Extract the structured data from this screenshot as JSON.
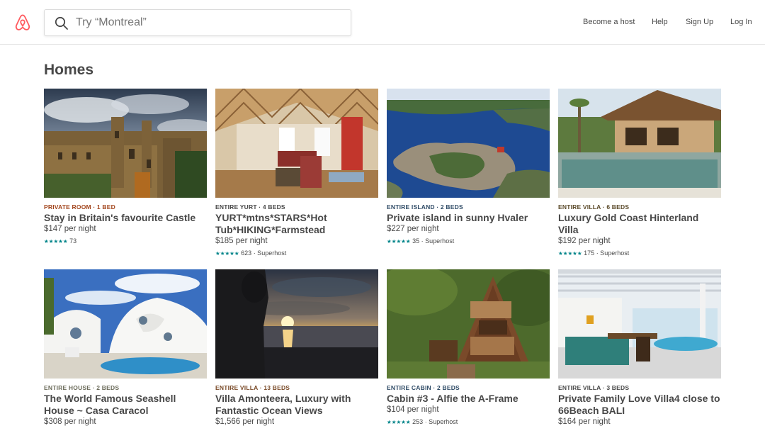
{
  "brand": {
    "accent": "#FF5A5F",
    "logo": "airbnb-belo-logo"
  },
  "search": {
    "placeholder": "Try “Montreal”",
    "icon": "search-icon"
  },
  "nav": {
    "become_host": "Become a host",
    "help": "Help",
    "sign_up": "Sign Up",
    "log_in": "Log In"
  },
  "section": {
    "title": "Homes"
  },
  "listings": [
    {
      "kicker": "PRIVATE ROOM · 1 BED",
      "kicker_color": "#A2451C",
      "name": "Stay in Britain's favourite Castle",
      "price": "$147 per night",
      "stars": "★★★★★",
      "rating": "73",
      "superhost": ""
    },
    {
      "kicker": "ENTIRE YURT · 4 BEDS",
      "kicker_color": "#484848",
      "name": "YURT*mtns*STARS*Hot Tub*HIKING*Farmstead",
      "price": "$185 per night",
      "stars": "★★★★★",
      "rating": "623",
      "superhost": "· Superhost"
    },
    {
      "kicker": "ENTIRE ISLAND · 2 BEDS",
      "kicker_color": "#2F4B66",
      "name": "Private island in sunny Hvaler",
      "price": "$227 per night",
      "stars": "★★★★★",
      "rating": "35",
      "superhost": "· Superhost"
    },
    {
      "kicker": "ENTIRE VILLA · 6 BEDS",
      "kicker_color": "#5B4A2A",
      "name": "Luxury Gold Coast Hinterland Villa",
      "price": "$192 per night",
      "stars": "★★★★★",
      "rating": "175",
      "superhost": "· Superhost"
    },
    {
      "kicker": "ENTIRE HOUSE · 2 BEDS",
      "kicker_color": "#6B6B5A",
      "name": "The World Famous Seashell House ~ Casa Caracol",
      "price": "$308 per night",
      "stars": "",
      "rating": "",
      "superhost": ""
    },
    {
      "kicker": "ENTIRE VILLA · 13 BEDS",
      "kicker_color": "#7A4B28",
      "name": "Villa Amonteera, Luxury with Fantastic Ocean Views",
      "price": "$1,566 per night",
      "stars": "",
      "rating": "",
      "superhost": ""
    },
    {
      "kicker": "ENTIRE CABIN · 2 BEDS",
      "kicker_color": "#2F4B66",
      "name": "Cabin #3 - Alfie the A-Frame",
      "price": "$104 per night",
      "stars": "★★★★★",
      "rating": "253",
      "superhost": "· Superhost"
    },
    {
      "kicker": "ENTIRE VILLA · 3 BEDS",
      "kicker_color": "#484848",
      "name": "Private Family Love Villa4 close to 66Beach BALI",
      "price": "$164 per night",
      "stars": "",
      "rating": "",
      "superhost": ""
    }
  ]
}
